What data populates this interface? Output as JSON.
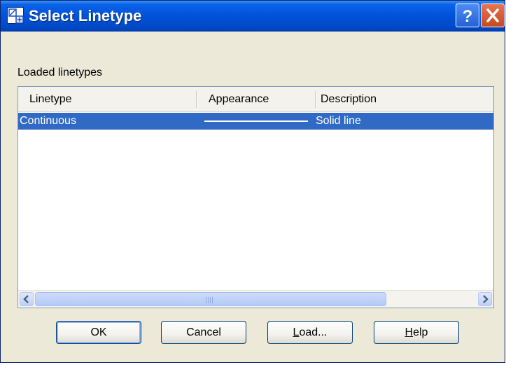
{
  "window": {
    "title": "Select Linetype"
  },
  "titlebar_buttons": {
    "help_glyph": "?",
    "close_icon": "close-icon"
  },
  "group": {
    "label": "Loaded linetypes"
  },
  "list": {
    "columns": [
      "Linetype",
      "Appearance",
      "Description"
    ],
    "rows": [
      {
        "linetype": "Continuous",
        "appearance": "solid-line",
        "description": "Solid line",
        "selected": true
      }
    ]
  },
  "scrollbar": {
    "left_icon": "scroll-left-icon",
    "right_icon": "scroll-right-icon"
  },
  "buttons": {
    "ok": "OK",
    "cancel": "Cancel",
    "load": {
      "mnemonic": "L",
      "rest": "oad..."
    },
    "help": {
      "mnemonic": "H",
      "rest": "elp"
    }
  },
  "colors": {
    "titlebar": "#0051d9",
    "selection": "#316ac5",
    "dialog_bg": "#ece9d8"
  }
}
